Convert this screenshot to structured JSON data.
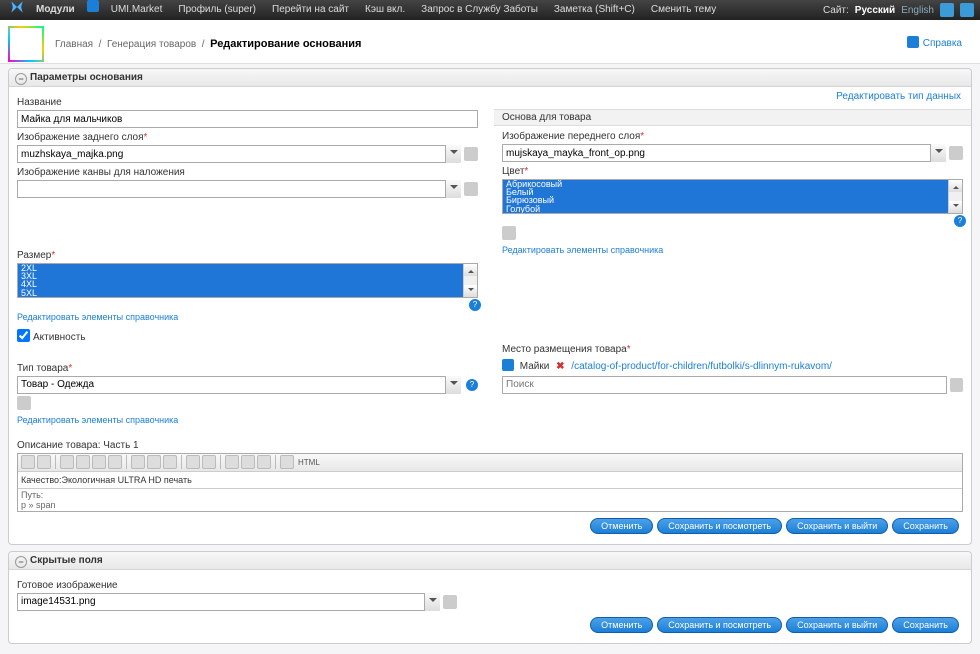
{
  "top": {
    "modules": "Модули",
    "umi_market": "UMI.Market",
    "profile": "Профиль (super)",
    "goto_site": "Перейти на сайт",
    "cache": "Кэш вкл.",
    "support": "Запрос в Службу Заботы",
    "note": "Заметка (Shift+C)",
    "theme": "Сменить тему",
    "site_label": "Сайт:",
    "lang_ru": "Русский",
    "lang_en": "English"
  },
  "breadcrumb": {
    "home": "Главная",
    "gen": "Генерация товаров",
    "current": "Редактирование основания"
  },
  "help": "Справка",
  "panel1": {
    "title": "Параметры основания",
    "edit_type": "Редактировать тип данных",
    "name_label": "Название",
    "name_value": "Майка для мальчиков",
    "back_layer_label": "Изображение заднего слоя",
    "back_layer_value": "muzhskaya_majka.png",
    "canvas_label": "Изображение канвы для наложения",
    "size_label": "Размер",
    "sizes": [
      "2XL",
      "3XL",
      "4XL",
      "5XL"
    ],
    "edit_ref": "Редактировать элементы справочника",
    "activity": "Активность",
    "type_label": "Тип товара",
    "type_value": "Товар - Одежда",
    "desc_label": "Описание товара: Часть 1",
    "desc_text": "Качество:Экологичная ULTRA HD печать",
    "path_label": "Путь:",
    "path_value": "p » span",
    "basis_hdr": "Основа для товара",
    "front_layer_label": "Изображение переднего слоя",
    "front_layer_value": "mujskaya_mayka_front_op.png",
    "color_label": "Цвет",
    "colors": [
      "Абрикосовый",
      "Белый",
      "Бирюзовый",
      "Голубой"
    ],
    "place_label": "Место размещения товара",
    "place_name": "Майки",
    "place_path": "/catalog-of-product/for-children/futbolki/s-dlinnym-rukavom/",
    "search_ph": "Поиск"
  },
  "panel2": {
    "title": "Скрытые поля",
    "ready_label": "Готовое изображение",
    "ready_value": "image14531.png"
  },
  "buttons": {
    "cancel": "Отменить",
    "save_view": "Сохранить и посмотреть",
    "save_exit": "Сохранить и выйти",
    "save": "Сохранить"
  }
}
